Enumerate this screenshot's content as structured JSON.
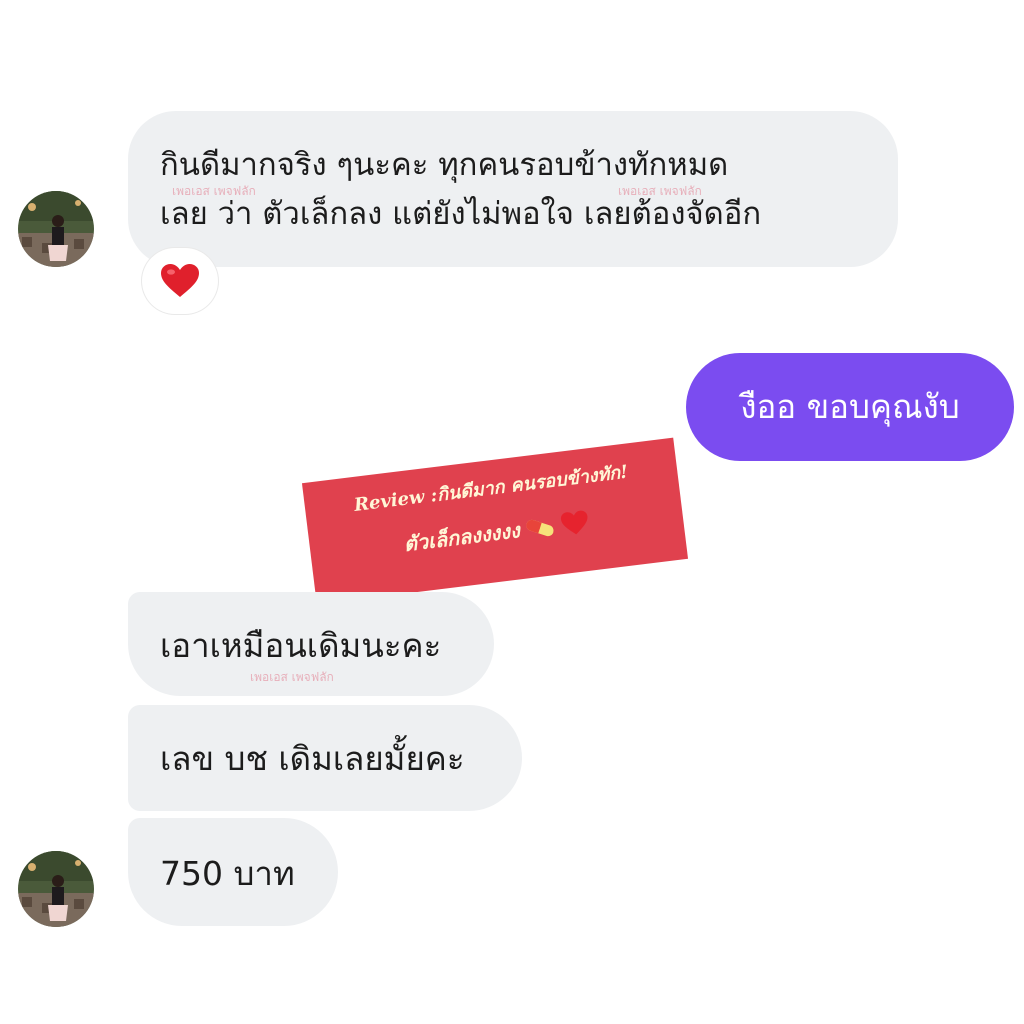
{
  "conversation": {
    "messages": [
      {
        "sender": "other",
        "text": "กินดีมากจริง ๆนะคะ ทุกคนรอบข้างทักหมด\nเลย ว่า ตัวเล็กลง แต่ยังไม่พอใจ เลยต้องจัดอีก",
        "reaction": "heart-icon"
      },
      {
        "sender": "self",
        "text": "งืออ ขอบคุณงับ"
      },
      {
        "sender": "other",
        "text": "เอาเหมือนเดิมนะคะ"
      },
      {
        "sender": "other",
        "text": "เลข บช เดิมเลยมั้ยคะ"
      },
      {
        "sender": "other",
        "text": "750 บาท"
      }
    ],
    "watermark": "เพอเอส เพจฟลัก"
  },
  "banner": {
    "line1": "Review :กินดีมาก คนรอบข้างทัก!",
    "line2": "ตัวเล็กลงงงงง"
  },
  "colors": {
    "incoming_bubble": "#eef0f2",
    "outgoing_bubble": "#7b4cf0",
    "banner": "#e0414e",
    "banner_text": "#fff6d6"
  }
}
